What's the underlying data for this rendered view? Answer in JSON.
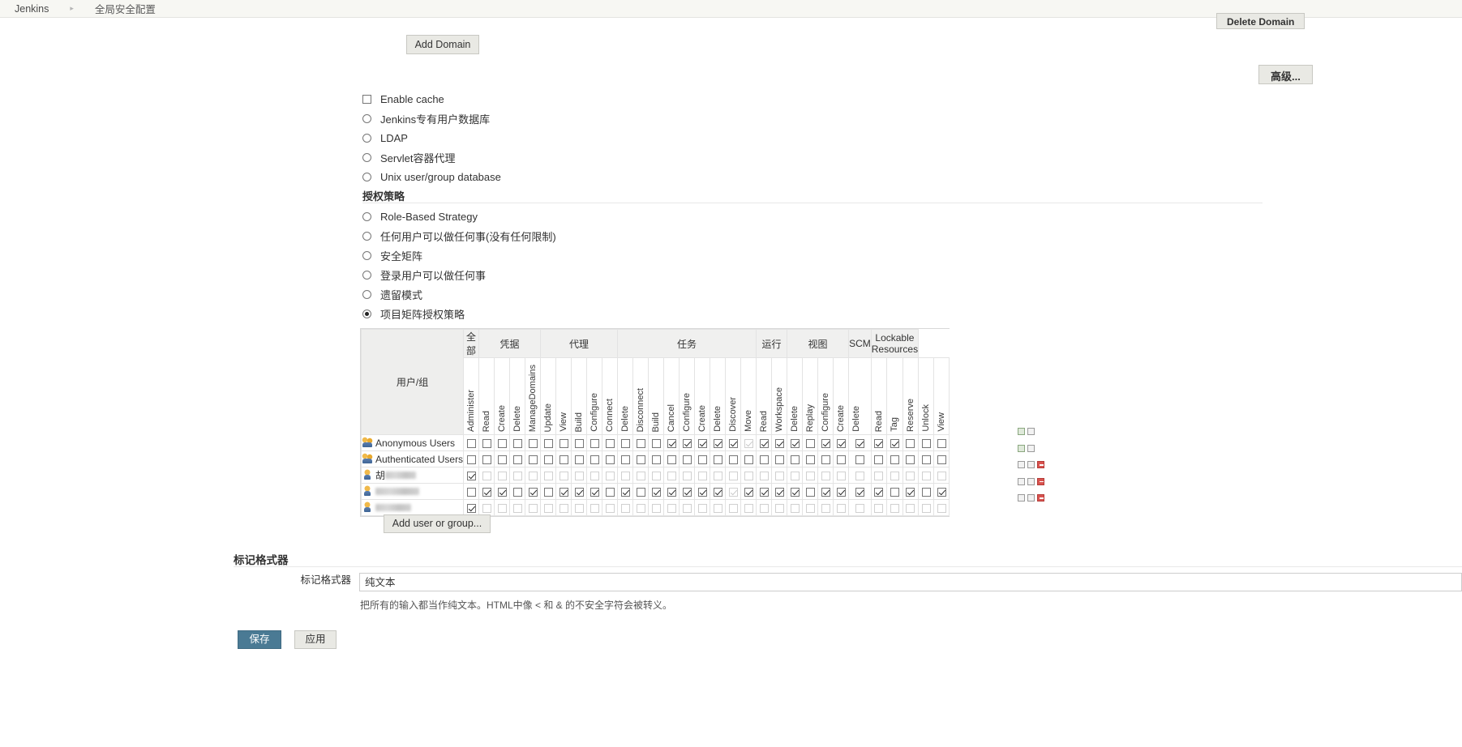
{
  "breadcrumb": {
    "root": "Jenkins",
    "current": "全局安全配置",
    "separator": "▸"
  },
  "buttons": {
    "delete_domain": "Delete Domain",
    "advanced": "高级...",
    "add_domain": "Add Domain",
    "add_user_or_group": "Add user or group...",
    "save": "保存",
    "apply": "应用"
  },
  "security_realm": {
    "options": [
      {
        "type": "checkbox",
        "label": "Enable cache",
        "checked": false
      },
      {
        "type": "radio",
        "label": "Jenkins专有用户数据库",
        "checked": false
      },
      {
        "type": "radio",
        "label": "LDAP",
        "checked": false
      },
      {
        "type": "radio",
        "label": "Servlet容器代理",
        "checked": false
      },
      {
        "type": "radio",
        "label": "Unix user/group database",
        "checked": false
      }
    ]
  },
  "authorization": {
    "heading": "授权策略",
    "options": [
      {
        "label": "Role-Based Strategy",
        "checked": false
      },
      {
        "label": "任何用户可以做任何事(没有任何限制)",
        "checked": false
      },
      {
        "label": "安全矩阵",
        "checked": false
      },
      {
        "label": "登录用户可以做任何事",
        "checked": false
      },
      {
        "label": "遗留模式",
        "checked": false
      },
      {
        "label": "项目矩阵授权策略",
        "checked": true
      }
    ]
  },
  "matrix": {
    "user_column_header": "用户/组",
    "groups": [
      {
        "label": "全部",
        "span": 1
      },
      {
        "label": "凭据",
        "span": 4
      },
      {
        "label": "代理",
        "span": 5
      },
      {
        "label": "任务",
        "span": 9
      },
      {
        "label": "运行",
        "span": 2
      },
      {
        "label": "视图",
        "span": 4
      },
      {
        "label": "SCM",
        "span": 1
      },
      {
        "label": "Lockable Resources",
        "span": 3
      }
    ],
    "columns": [
      "Administer",
      "Read",
      "Create",
      "Delete",
      "ManageDomains",
      "Update",
      "View",
      "Build",
      "Configure",
      "Connect",
      "Delete",
      "Disconnect",
      "Build",
      "Cancel",
      "Configure",
      "Create",
      "Delete",
      "Discover",
      "Move",
      "Read",
      "Workspace",
      "Delete",
      "Replay",
      "Configure",
      "Create",
      "Delete",
      "Read",
      "Tag",
      "Reserve",
      "Unlock",
      "View"
    ],
    "rows": [
      {
        "name": "Anonymous Users",
        "icon": "group-icon",
        "blurred": false,
        "dim": false,
        "checks": [
          0,
          0,
          0,
          0,
          0,
          0,
          0,
          0,
          0,
          0,
          0,
          0,
          0,
          1,
          1,
          1,
          1,
          1,
          2,
          1,
          1,
          1,
          0,
          1,
          1,
          1,
          1,
          1,
          0,
          0,
          0
        ],
        "actions": [
          "green",
          "grey"
        ]
      },
      {
        "name": "Authenticated Users",
        "icon": "group-icon",
        "blurred": false,
        "dim": false,
        "checks": [
          0,
          0,
          0,
          0,
          0,
          0,
          0,
          0,
          0,
          0,
          0,
          0,
          0,
          0,
          0,
          0,
          0,
          0,
          0,
          0,
          0,
          0,
          0,
          0,
          0,
          0,
          0,
          0,
          0,
          0,
          0
        ],
        "actions": [
          "green",
          "grey"
        ]
      },
      {
        "name": "胡",
        "icon": "user-icon",
        "blurred": true,
        "blur_width": 38,
        "dim": true,
        "checks": [
          1,
          0,
          0,
          0,
          0,
          0,
          0,
          0,
          0,
          0,
          0,
          0,
          0,
          0,
          0,
          0,
          0,
          0,
          0,
          0,
          0,
          0,
          0,
          0,
          0,
          0,
          0,
          0,
          0,
          0,
          0
        ],
        "actions": [
          "grey",
          "grey",
          "red"
        ]
      },
      {
        "name": "",
        "icon": "user-icon",
        "blurred": true,
        "blur_width": 54,
        "dim": false,
        "checks": [
          0,
          1,
          1,
          0,
          1,
          0,
          1,
          1,
          1,
          0,
          1,
          0,
          1,
          1,
          1,
          1,
          1,
          2,
          1,
          1,
          1,
          1,
          0,
          1,
          1,
          1,
          1,
          0,
          1,
          0,
          1
        ],
        "actions": [
          "grey",
          "grey",
          "red"
        ]
      },
      {
        "name": "",
        "icon": "user-icon",
        "blurred": true,
        "blur_width": 44,
        "dim": true,
        "checks": [
          1,
          0,
          0,
          0,
          0,
          0,
          0,
          0,
          0,
          0,
          0,
          0,
          0,
          0,
          0,
          0,
          0,
          0,
          0,
          0,
          0,
          0,
          0,
          0,
          0,
          0,
          0,
          0,
          0,
          0,
          0
        ],
        "actions": [
          "grey",
          "grey",
          "red"
        ]
      }
    ]
  },
  "markup_formatter": {
    "heading": "标记格式器",
    "field_label": "标记格式器",
    "selected_value": "纯文本",
    "description": "把所有的输入都当作纯文本。HTML中像 < 和 & 的不安全字符会被转义。"
  }
}
